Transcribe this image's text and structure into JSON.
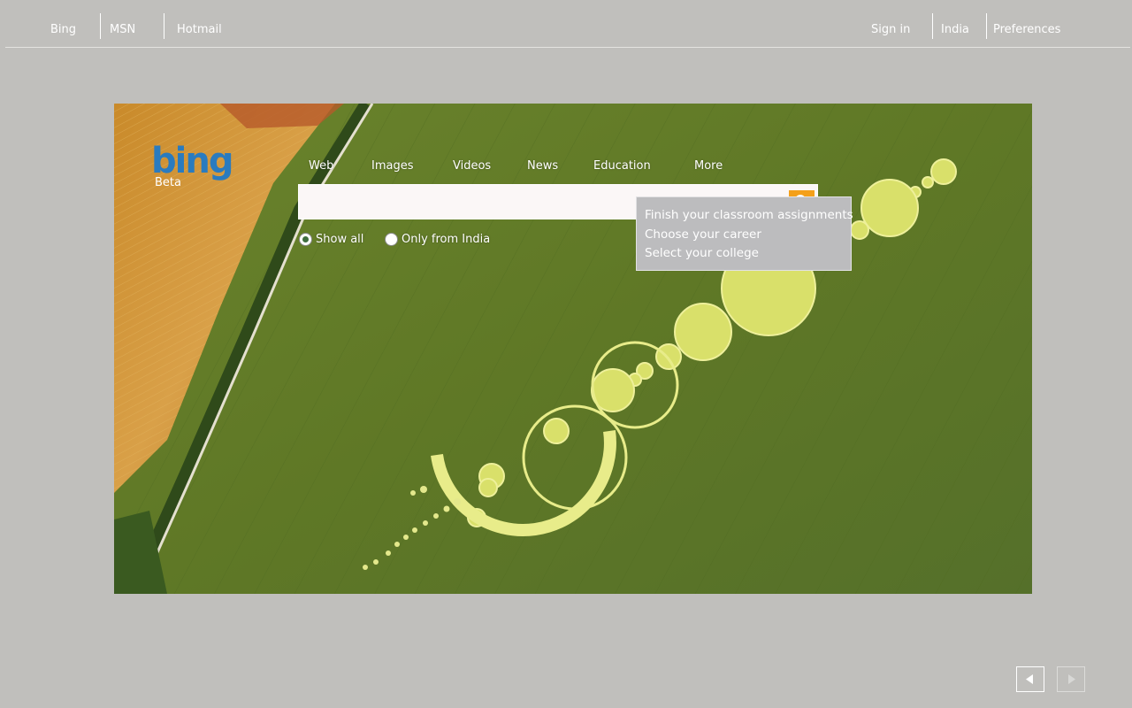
{
  "topnav": {
    "left": [
      "Bing",
      "MSN",
      "Hotmail"
    ],
    "right": [
      "Sign in",
      "India",
      "Preferences"
    ]
  },
  "logo": {
    "brand": "bing",
    "tag": "Beta"
  },
  "tabs": [
    "Web",
    "Images",
    "Videos",
    "News",
    "Education",
    "More"
  ],
  "search": {
    "value": "",
    "placeholder": ""
  },
  "scope": {
    "options": [
      "Show all",
      "Only from India"
    ],
    "selected": "Show all"
  },
  "dropdown": {
    "items": [
      "Finish your classroom assignments",
      "Choose your career",
      "Select your college"
    ]
  },
  "colors": {
    "page_bg": "#c0bfbc",
    "brand_blue": "#2a7bbf",
    "search_button": "#f4a01a",
    "dropdown_bg": "#bcbcbe"
  },
  "icons": {
    "search_button": "search-icon",
    "prev": "triangle-left-icon",
    "next": "triangle-right-icon"
  }
}
